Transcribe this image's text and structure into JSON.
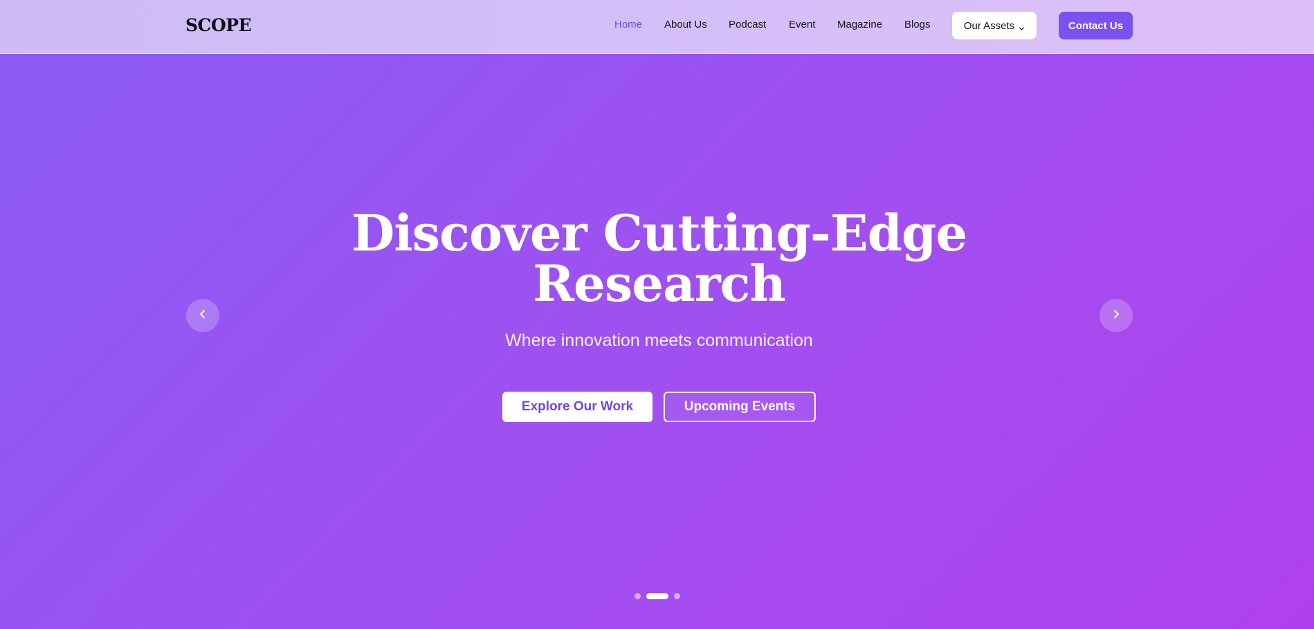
{
  "header": {
    "logo": "SCOPE",
    "nav": [
      {
        "label": "Home",
        "active": true
      },
      {
        "label": "About Us",
        "active": false
      },
      {
        "label": "Podcast",
        "active": false
      },
      {
        "label": "Event",
        "active": false
      },
      {
        "label": "Magazine",
        "active": false
      },
      {
        "label": "Blogs",
        "active": false
      }
    ],
    "assets_label": "Our Assets",
    "assets_icon": "chevron-down-icon",
    "contact_label": "Contact Us"
  },
  "hero": {
    "title_line1": "Discover Cutting-Edge",
    "title_line2": "Research",
    "subtitle": "Where innovation meets communication",
    "primary_cta": "Explore Our Work",
    "secondary_cta": "Upcoming Events",
    "prev_icon": "chevron-left-icon",
    "next_icon": "chevron-right-icon"
  },
  "slider": {
    "slide_count": 3,
    "active_slide": 2
  },
  "colors": {
    "accent": "#7a52f0",
    "active_nav": "#6d4fe0",
    "hero_gradient_start": "#8b5cf6",
    "hero_gradient_end": "#b040ee",
    "header_bg": "#d6bff8"
  }
}
